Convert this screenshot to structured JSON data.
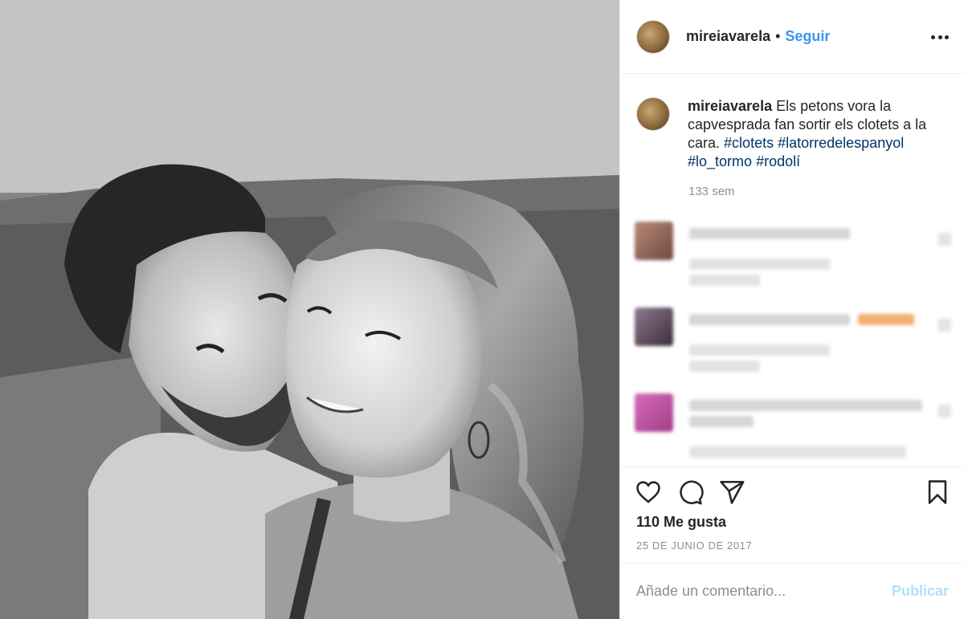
{
  "post": {
    "photo_alt": "",
    "author": "mireiavarela",
    "separator": "•",
    "follow_label": "Seguir",
    "caption_text": "Els petons vora la capvesprada fan sortir els clotets a la cara.",
    "hashtags": [
      "#clotets",
      "#latorredelespanyol",
      "#lo_tormo",
      "#rodolí"
    ],
    "time_ago": "133 sem",
    "likes": "110 Me gusta",
    "date": "25 DE JUNIO DE 2017"
  },
  "comment_form": {
    "placeholder": "Añade un comentario...",
    "publish_label": "Publicar"
  },
  "icons": {
    "more": "more-options-icon",
    "like": "heart-icon",
    "comment": "comment-bubble-icon",
    "share": "paper-plane-icon",
    "save": "bookmark-icon"
  },
  "colors": {
    "link_blue": "#3897f0",
    "hashtag_blue": "#003569",
    "publish_disabled": "#b2dffc",
    "muted_gray": "#8e8e8e"
  }
}
